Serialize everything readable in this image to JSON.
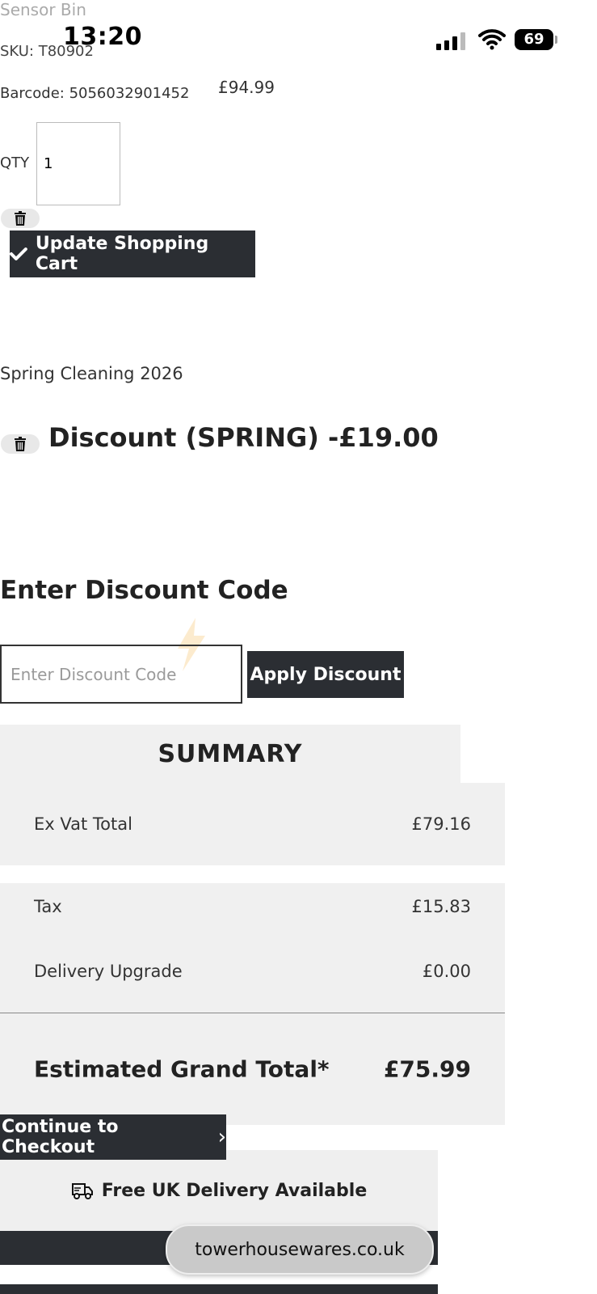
{
  "status_bar": {
    "time": "13:20",
    "battery": "69",
    "icons": [
      "signal-icon",
      "wifi-icon",
      "battery-icon"
    ]
  },
  "product": {
    "name": "Sensor Bin",
    "sku": "SKU: T80902",
    "barcode": "Barcode: 5056032901452",
    "price": "£94.99",
    "qty_label": "QTY",
    "qty_value": "1"
  },
  "cart": {
    "update_label": "Update Shopping Cart"
  },
  "promotion": {
    "name": "Spring Cleaning 2026",
    "discount_line": "Discount (SPRING) -£19.00"
  },
  "discount_code": {
    "title": "Enter Discount Code",
    "placeholder": "Enter Discount Code",
    "apply_label": "Apply Discount"
  },
  "summary": {
    "title": "SUMMARY",
    "rows": [
      {
        "label": "Ex Vat Total",
        "value": "£79.16"
      },
      {
        "label": "Tax",
        "value": "£15.83"
      },
      {
        "label": "Delivery Upgrade",
        "value": "£0.00"
      }
    ],
    "grand_label": "Estimated Grand Total*",
    "grand_value": "£75.99"
  },
  "checkout": {
    "label": "Continue to Checkout",
    "chevron": "›"
  },
  "delivery": {
    "label": "Free UK Delivery Available"
  },
  "browser": {
    "url": "towerhousewares.co.uk"
  },
  "colors": {
    "button_bg": "#2b2e33",
    "summary_bg": "#f0f0f0"
  }
}
